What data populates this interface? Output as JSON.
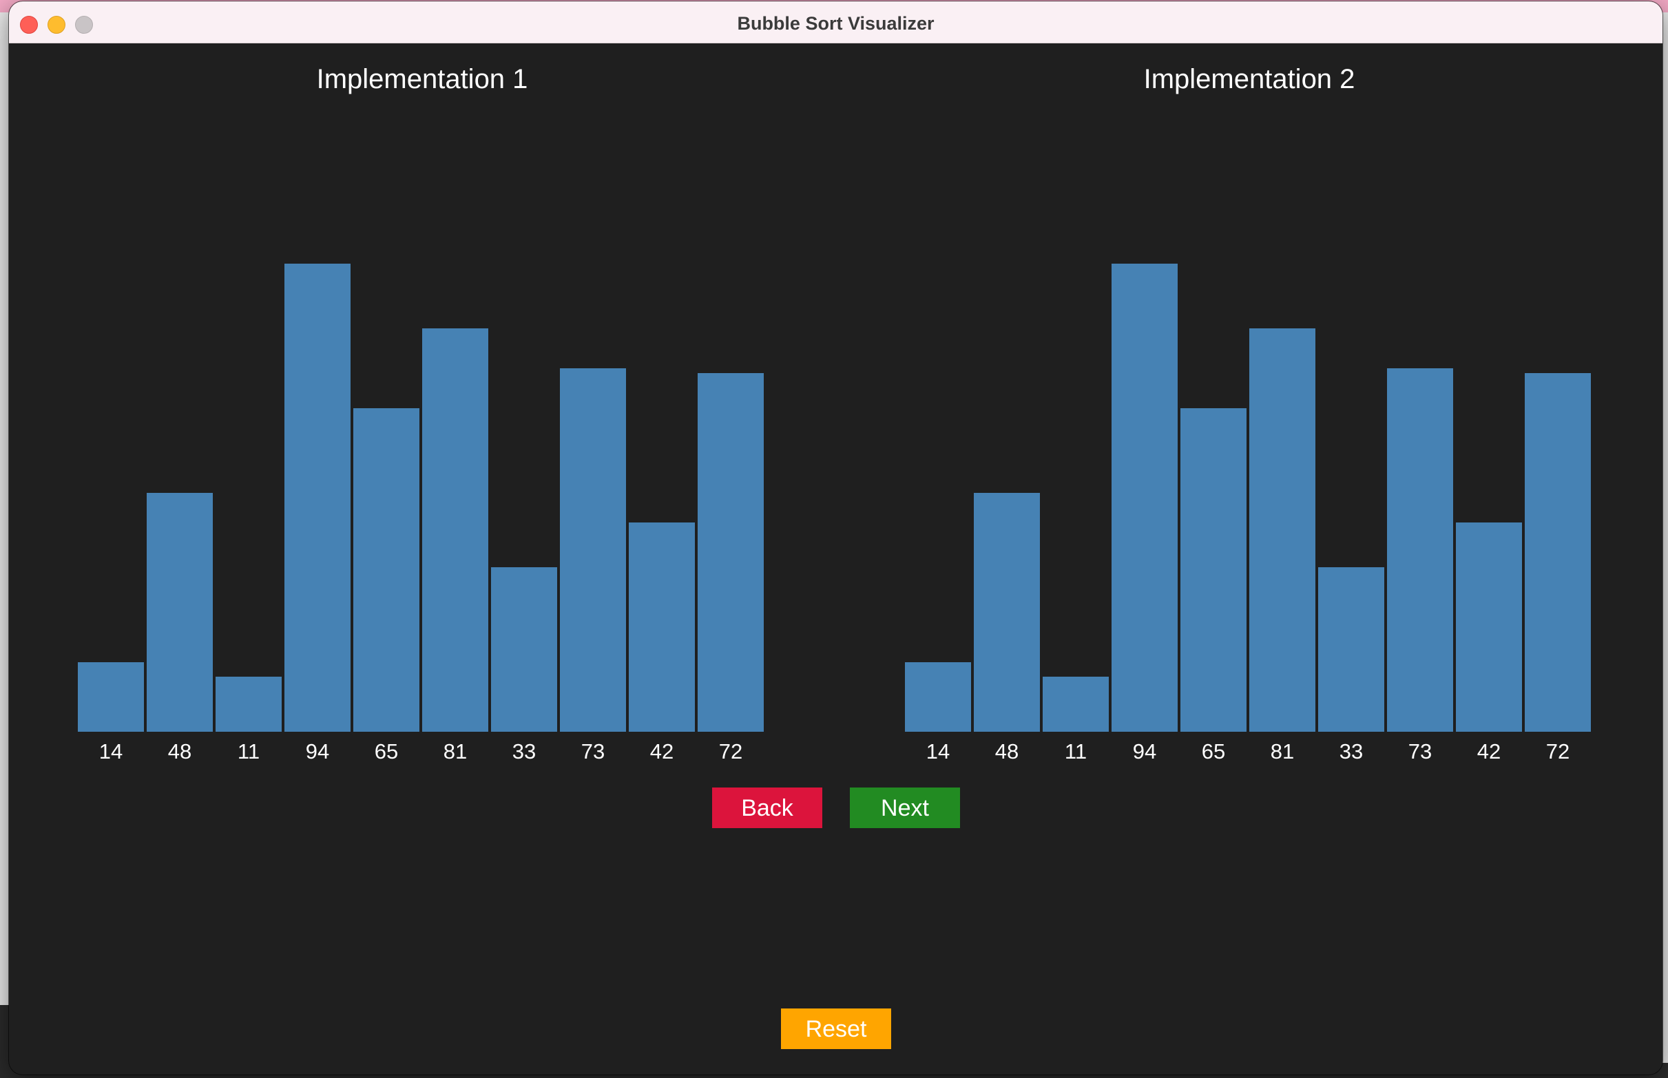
{
  "window": {
    "title": "Bubble Sort Visualizer"
  },
  "panels": [
    {
      "title": "Implementation 1"
    },
    {
      "title": "Implementation 2"
    }
  ],
  "chart_data": [
    {
      "type": "bar",
      "title": "Implementation 1",
      "categories": [
        "14",
        "48",
        "11",
        "94",
        "65",
        "81",
        "33",
        "73",
        "42",
        "72"
      ],
      "values": [
        14,
        48,
        11,
        94,
        65,
        81,
        33,
        73,
        42,
        72
      ],
      "ylim": [
        0,
        100
      ],
      "grid": false,
      "bar_color": "#4682b4"
    },
    {
      "type": "bar",
      "title": "Implementation 2",
      "categories": [
        "14",
        "48",
        "11",
        "94",
        "65",
        "81",
        "33",
        "73",
        "42",
        "72"
      ],
      "values": [
        14,
        48,
        11,
        94,
        65,
        81,
        33,
        73,
        42,
        72
      ],
      "ylim": [
        0,
        100
      ],
      "grid": false,
      "bar_color": "#4682b4"
    }
  ],
  "controls": {
    "back_label": "Back",
    "next_label": "Next",
    "reset_label": "Reset"
  },
  "colors": {
    "background": "#1f1f1f",
    "bar": "#4682b4",
    "back": "#dc143c",
    "next": "#228b22",
    "reset": "#ffa500",
    "text": "#ffffff"
  }
}
